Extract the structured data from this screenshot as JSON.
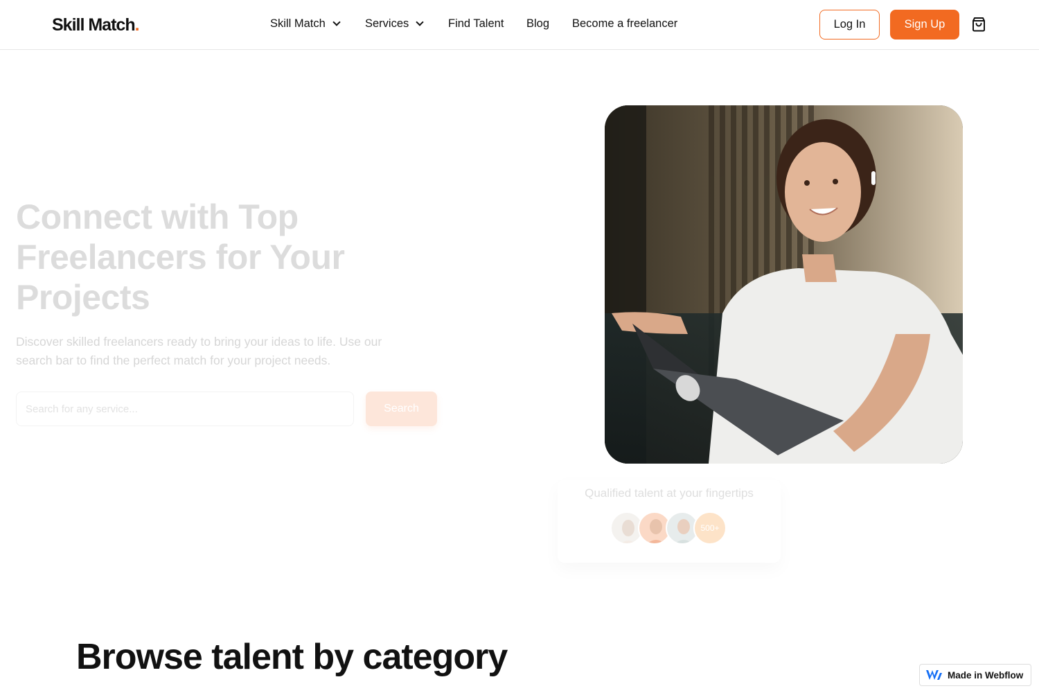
{
  "header": {
    "logo_text": "Skill Match",
    "logo_dot": ".",
    "nav": [
      {
        "label": "Skill Match",
        "has_dropdown": true
      },
      {
        "label": "Services",
        "has_dropdown": true
      },
      {
        "label": "Find Talent",
        "has_dropdown": false
      },
      {
        "label": "Blog",
        "has_dropdown": false
      },
      {
        "label": "Become a freelancer",
        "has_dropdown": false
      }
    ],
    "login_label": "Log In",
    "signup_label": "Sign Up",
    "cart_icon": "shopping-bag-icon"
  },
  "hero": {
    "title": "Connect with Top Freelancers for Your Projects",
    "subtitle": "Discover skilled freelancers ready to bring your ideas to life. Use our search bar to find the perfect match for your project needs.",
    "search_placeholder": "Search for any service...",
    "search_button": "Search"
  },
  "talent_card": {
    "text": "Qualified talent at your fingertips",
    "count": "500+"
  },
  "section": {
    "title": "Browse talent by category"
  },
  "badge": {
    "label": "Made in Webflow"
  },
  "colors": {
    "accent": "#f26a21",
    "text": "#111111",
    "border": "#e6e6e6"
  }
}
